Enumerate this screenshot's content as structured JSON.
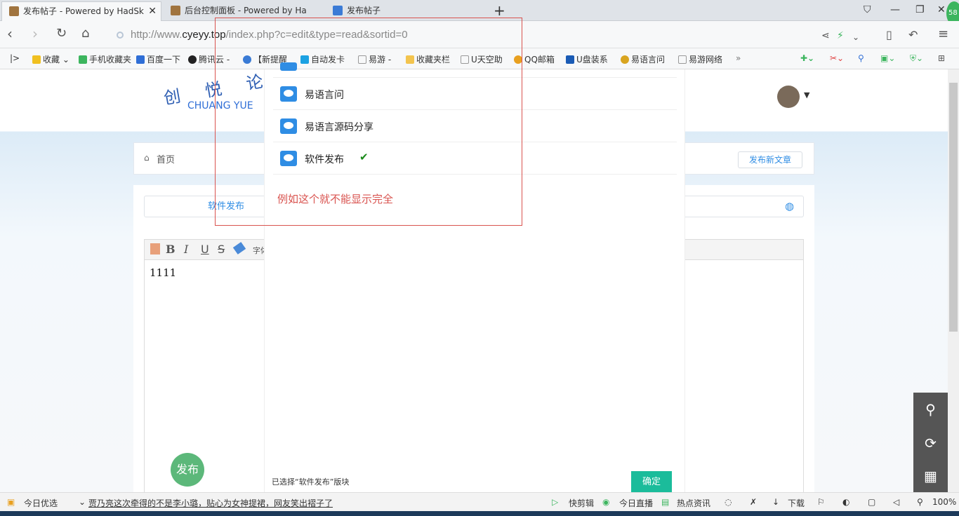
{
  "tabs": [
    {
      "title": "发布帖子 - Powered by HadSk",
      "active": true
    },
    {
      "title": "后台控制面板 - Powered by Ha",
      "active": false
    },
    {
      "title": "发布帖子",
      "active": false
    }
  ],
  "address": {
    "prefix": "http://www.",
    "domain": "cyeyy.top",
    "path": "/index.php?c=edit&type=read&sortid=0"
  },
  "badge_count": "58",
  "bookmarks": [
    "收藏",
    "手机收藏夹",
    "百度一下",
    "腾讯云 -",
    "【新提醒",
    "自动发卡",
    "易游 -",
    "收藏夹栏",
    "U天空助",
    "QQ邮箱",
    "U盘装系",
    "易语言问",
    "易游网络"
  ],
  "site": {
    "logo_cn": "创 悦 论 坛",
    "logo_en": "CHUANG YUE",
    "breadcrumb_home": "首页",
    "new_article": "发布新文章",
    "category_tab": "软件发布",
    "editor_font_label": "字体",
    "editor_content": "1111",
    "publish": "发布"
  },
  "popup": {
    "items": [
      "易语言问",
      "易语言源码分享",
      "软件发布"
    ],
    "selected_index": 2,
    "annotation": "例如这个就不能显示完全",
    "selected_text": "已选择“软件发布”版块",
    "confirm": "确定"
  },
  "status": {
    "left_label": "今日优选",
    "news": "贾乃亮这次牵得的不是李小璐，贴心为女神提裙，网友笑出褶子了",
    "items": [
      "快剪辑",
      "今日直播",
      "热点资讯",
      "下载"
    ],
    "zoom": "100%"
  },
  "colors": {
    "accent": "#1bbc9b",
    "link": "#2f8de4",
    "annotation": "#d9534f"
  }
}
